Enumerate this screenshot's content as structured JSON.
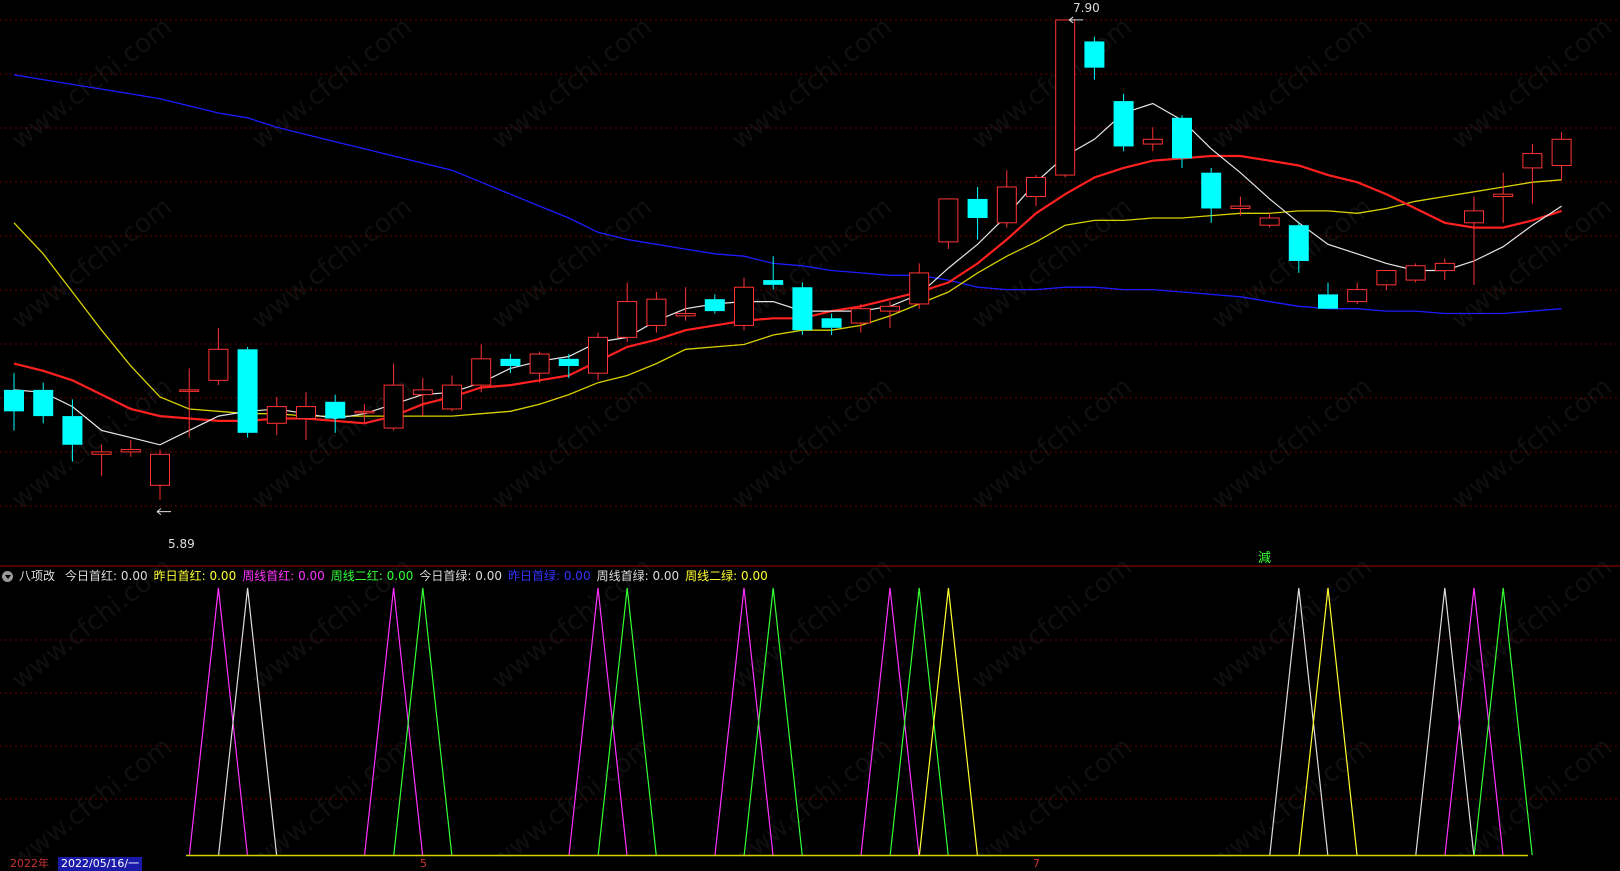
{
  "colors": {
    "up": "#ff3333",
    "down": "#00ffff",
    "ma_white": "#e6e6e6",
    "ma_red": "#ff2020",
    "ma_yellow": "#d7d000",
    "ma_blue": "#1c1cff",
    "grid": "#6e0000",
    "separator": "#a00000"
  },
  "price_labels": {
    "high": "7.90",
    "low": "5.89"
  },
  "signal_label": "減",
  "indicator": {
    "title": "八项改",
    "items": [
      {
        "label": "今日首红:",
        "value": "0.00",
        "color": "#dddddd"
      },
      {
        "label": "昨日首红:",
        "value": "0.00",
        "color": "#ffff33"
      },
      {
        "label": "周线首红:",
        "value": "0.00",
        "color": "#ff33ff"
      },
      {
        "label": "周线二红:",
        "value": "0.00",
        "color": "#33ff33"
      },
      {
        "label": "今日首绿:",
        "value": "0.00",
        "color": "#dddddd"
      },
      {
        "label": "昨日首绿:",
        "value": "0.00",
        "color": "#3333ff"
      },
      {
        "label": "周线首绿:",
        "value": "0.00",
        "color": "#dddddd"
      },
      {
        "label": "周线二绿:",
        "value": "0.00",
        "color": "#ffff33"
      }
    ]
  },
  "date_axis": {
    "year": "2022年",
    "current": "2022/05/16/一",
    "month_marks": [
      "5",
      "7"
    ]
  },
  "watermark": "www.cfchi.com",
  "chart_data": {
    "type": "candlestick",
    "price_range": [
      5.7,
      7.95
    ],
    "candles": [
      {
        "o": 6.35,
        "h": 6.42,
        "l": 6.18,
        "c": 6.26,
        "dir": "down"
      },
      {
        "o": 6.35,
        "h": 6.38,
        "l": 6.21,
        "c": 6.24,
        "dir": "down"
      },
      {
        "o": 6.24,
        "h": 6.31,
        "l": 6.05,
        "c": 6.12,
        "dir": "down"
      },
      {
        "o": 6.08,
        "h": 6.12,
        "l": 5.99,
        "c": 6.09,
        "dir": "up"
      },
      {
        "o": 6.09,
        "h": 6.14,
        "l": 6.07,
        "c": 6.1,
        "dir": "up"
      },
      {
        "o": 5.95,
        "h": 6.1,
        "l": 5.89,
        "c": 6.08,
        "dir": "up"
      },
      {
        "o": 6.35,
        "h": 6.44,
        "l": 6.15,
        "c": 6.35,
        "dir": "up"
      },
      {
        "o": 6.39,
        "h": 6.61,
        "l": 6.37,
        "c": 6.52,
        "dir": "up"
      },
      {
        "o": 6.52,
        "h": 6.53,
        "l": 6.15,
        "c": 6.17,
        "dir": "down"
      },
      {
        "o": 6.21,
        "h": 6.32,
        "l": 6.16,
        "c": 6.28,
        "dir": "up"
      },
      {
        "o": 6.23,
        "h": 6.34,
        "l": 6.14,
        "c": 6.28,
        "dir": "up"
      },
      {
        "o": 6.3,
        "h": 6.33,
        "l": 6.17,
        "c": 6.23,
        "dir": "down"
      },
      {
        "o": 6.26,
        "h": 6.29,
        "l": 6.21,
        "c": 6.26,
        "dir": "up"
      },
      {
        "o": 6.19,
        "h": 6.46,
        "l": 6.18,
        "c": 6.37,
        "dir": "up"
      },
      {
        "o": 6.33,
        "h": 6.4,
        "l": 6.24,
        "c": 6.35,
        "dir": "up"
      },
      {
        "o": 6.27,
        "h": 6.41,
        "l": 6.26,
        "c": 6.37,
        "dir": "up"
      },
      {
        "o": 6.37,
        "h": 6.54,
        "l": 6.34,
        "c": 6.48,
        "dir": "up"
      },
      {
        "o": 6.48,
        "h": 6.5,
        "l": 6.42,
        "c": 6.45,
        "dir": "down"
      },
      {
        "o": 6.42,
        "h": 6.51,
        "l": 6.38,
        "c": 6.5,
        "dir": "up"
      },
      {
        "o": 6.48,
        "h": 6.5,
        "l": 6.4,
        "c": 6.45,
        "dir": "down"
      },
      {
        "o": 6.42,
        "h": 6.59,
        "l": 6.39,
        "c": 6.57,
        "dir": "up"
      },
      {
        "o": 6.57,
        "h": 6.8,
        "l": 6.55,
        "c": 6.72,
        "dir": "up"
      },
      {
        "o": 6.62,
        "h": 6.76,
        "l": 6.59,
        "c": 6.73,
        "dir": "up"
      },
      {
        "o": 6.66,
        "h": 6.78,
        "l": 6.64,
        "c": 6.67,
        "dir": "up"
      },
      {
        "o": 6.73,
        "h": 6.75,
        "l": 6.67,
        "c": 6.68,
        "dir": "down"
      },
      {
        "o": 6.62,
        "h": 6.82,
        "l": 6.6,
        "c": 6.78,
        "dir": "up"
      },
      {
        "o": 6.81,
        "h": 6.91,
        "l": 6.77,
        "c": 6.79,
        "dir": "down"
      },
      {
        "o": 6.78,
        "h": 6.8,
        "l": 6.58,
        "c": 6.6,
        "dir": "down"
      },
      {
        "o": 6.65,
        "h": 6.67,
        "l": 6.58,
        "c": 6.61,
        "dir": "down"
      },
      {
        "o": 6.63,
        "h": 6.71,
        "l": 6.59,
        "c": 6.69,
        "dir": "up"
      },
      {
        "o": 6.68,
        "h": 6.72,
        "l": 6.61,
        "c": 6.7,
        "dir": "up"
      },
      {
        "o": 6.71,
        "h": 6.88,
        "l": 6.69,
        "c": 6.84,
        "dir": "up"
      },
      {
        "o": 6.97,
        "h": 7.13,
        "l": 6.94,
        "c": 7.15,
        "dir": "up"
      },
      {
        "o": 7.15,
        "h": 7.2,
        "l": 6.98,
        "c": 7.07,
        "dir": "down"
      },
      {
        "o": 7.05,
        "h": 7.27,
        "l": 7.03,
        "c": 7.2,
        "dir": "up"
      },
      {
        "o": 7.16,
        "h": 7.25,
        "l": 7.12,
        "c": 7.24,
        "dir": "up"
      },
      {
        "o": 7.25,
        "h": 7.9,
        "l": 7.24,
        "c": 7.9,
        "dir": "up"
      },
      {
        "o": 7.81,
        "h": 7.83,
        "l": 7.65,
        "c": 7.7,
        "dir": "down"
      },
      {
        "o": 7.56,
        "h": 7.59,
        "l": 7.35,
        "c": 7.37,
        "dir": "down"
      },
      {
        "o": 7.4,
        "h": 7.45,
        "l": 7.35,
        "c": 7.38,
        "dir": "up"
      },
      {
        "o": 7.49,
        "h": 7.5,
        "l": 7.28,
        "c": 7.32,
        "dir": "down"
      },
      {
        "o": 7.26,
        "h": 7.28,
        "l": 7.05,
        "c": 7.11,
        "dir": "down"
      },
      {
        "o": 7.11,
        "h": 7.16,
        "l": 7.08,
        "c": 7.12,
        "dir": "up"
      },
      {
        "o": 7.07,
        "h": 7.09,
        "l": 7.03,
        "c": 7.04,
        "dir": "up"
      },
      {
        "o": 7.04,
        "h": 7.05,
        "l": 6.84,
        "c": 6.89,
        "dir": "down"
      },
      {
        "o": 6.75,
        "h": 6.8,
        "l": 6.69,
        "c": 6.69,
        "dir": "down"
      },
      {
        "o": 6.72,
        "h": 6.8,
        "l": 6.71,
        "c": 6.77,
        "dir": "up"
      },
      {
        "o": 6.79,
        "h": 6.85,
        "l": 6.77,
        "c": 6.85,
        "dir": "up"
      },
      {
        "o": 6.81,
        "h": 6.88,
        "l": 6.8,
        "c": 6.87,
        "dir": "up"
      },
      {
        "o": 6.85,
        "h": 6.9,
        "l": 6.81,
        "c": 6.88,
        "dir": "up"
      },
      {
        "o": 7.1,
        "h": 7.16,
        "l": 6.79,
        "c": 7.05,
        "dir": "up"
      },
      {
        "o": 7.16,
        "h": 7.26,
        "l": 7.05,
        "c": 7.17,
        "dir": "up"
      },
      {
        "o": 7.28,
        "h": 7.38,
        "l": 7.13,
        "c": 7.34,
        "dir": "up"
      },
      {
        "o": 7.29,
        "h": 7.43,
        "l": 7.23,
        "c": 7.4,
        "dir": "up"
      }
    ],
    "ma": {
      "white": [
        6.35,
        6.34,
        6.28,
        6.18,
        6.15,
        6.12,
        6.18,
        6.24,
        6.26,
        6.27,
        6.25,
        6.23,
        6.25,
        6.29,
        6.33,
        6.34,
        6.38,
        6.44,
        6.47,
        6.49,
        6.55,
        6.57,
        6.64,
        6.69,
        6.71,
        6.72,
        6.72,
        6.68,
        6.68,
        6.68,
        6.7,
        6.75,
        6.86,
        6.96,
        7.08,
        7.22,
        7.33,
        7.4,
        7.51,
        7.55,
        7.48,
        7.36,
        7.26,
        7.15,
        7.05,
        6.96,
        6.92,
        6.88,
        6.85,
        6.85,
        6.89,
        6.95,
        7.04,
        7.12
      ],
      "red": [
        6.46,
        6.43,
        6.39,
        6.33,
        6.27,
        6.24,
        6.23,
        6.22,
        6.22,
        6.23,
        6.23,
        6.22,
        6.21,
        6.24,
        6.29,
        6.32,
        6.36,
        6.37,
        6.39,
        6.41,
        6.47,
        6.53,
        6.56,
        6.6,
        6.62,
        6.64,
        6.65,
        6.65,
        6.68,
        6.7,
        6.73,
        6.76,
        6.8,
        6.88,
        6.98,
        7.09,
        7.17,
        7.24,
        7.28,
        7.31,
        7.32,
        7.33,
        7.33,
        7.31,
        7.29,
        7.25,
        7.22,
        7.17,
        7.11,
        7.05,
        7.03,
        7.03,
        7.06,
        7.1
      ],
      "yellow": [
        7.05,
        6.92,
        6.76,
        6.6,
        6.45,
        6.32,
        6.27,
        6.26,
        6.25,
        6.25,
        6.24,
        6.24,
        6.24,
        6.24,
        6.24,
        6.24,
        6.25,
        6.26,
        6.29,
        6.33,
        6.38,
        6.41,
        6.46,
        6.52,
        6.53,
        6.54,
        6.58,
        6.6,
        6.6,
        6.62,
        6.66,
        6.71,
        6.76,
        6.84,
        6.91,
        6.97,
        7.04,
        7.06,
        7.06,
        7.07,
        7.07,
        7.08,
        7.09,
        7.09,
        7.1,
        7.1,
        7.09,
        7.11,
        7.14,
        7.16,
        7.18,
        7.2,
        7.22,
        7.23
      ],
      "blue": [
        7.67,
        7.65,
        7.63,
        7.61,
        7.59,
        7.57,
        7.54,
        7.51,
        7.49,
        7.45,
        7.42,
        7.39,
        7.36,
        7.33,
        7.3,
        7.27,
        7.22,
        7.17,
        7.12,
        7.07,
        7.01,
        6.98,
        6.96,
        6.94,
        6.92,
        6.91,
        6.88,
        6.87,
        6.85,
        6.84,
        6.83,
        6.83,
        6.81,
        6.78,
        6.77,
        6.77,
        6.78,
        6.78,
        6.77,
        6.77,
        6.76,
        6.75,
        6.74,
        6.72,
        6.7,
        6.69,
        6.69,
        6.68,
        6.68,
        6.67,
        6.67,
        6.67,
        6.68,
        6.69
      ]
    },
    "signals": [
      {
        "bar": 7,
        "color": "#ff33ff"
      },
      {
        "bar": 8,
        "color": "#dddddd"
      },
      {
        "bar": 13,
        "color": "#ff33ff"
      },
      {
        "bar": 14,
        "color": "#33ff33"
      },
      {
        "bar": 20,
        "color": "#ff33ff"
      },
      {
        "bar": 21,
        "color": "#33ff33"
      },
      {
        "bar": 25,
        "color": "#ff33ff"
      },
      {
        "bar": 26,
        "color": "#33ff33"
      },
      {
        "bar": 30,
        "color": "#ff33ff"
      },
      {
        "bar": 31,
        "color": "#33ff33"
      },
      {
        "bar": 32,
        "color": "#ffff33"
      },
      {
        "bar": 44,
        "color": "#dddddd"
      },
      {
        "bar": 45,
        "color": "#ffff33"
      },
      {
        "bar": 49,
        "color": "#dddddd"
      },
      {
        "bar": 50,
        "color": "#ff33ff"
      },
      {
        "bar": 51,
        "color": "#33ff33"
      }
    ]
  }
}
